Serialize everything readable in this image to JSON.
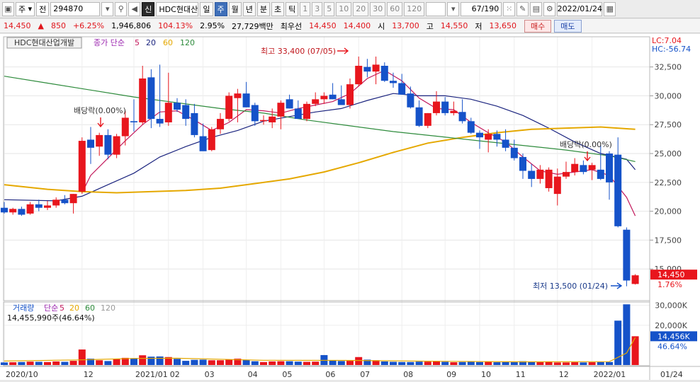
{
  "toolbar": {
    "market": "주",
    "prev_label": "전",
    "code": "294870",
    "sin_label": "신",
    "stock_name": "HDC현대산업",
    "periods": [
      "일",
      "주",
      "월",
      "년",
      "분",
      "초",
      "틱"
    ],
    "selected_period": "주",
    "numbers": [
      "1",
      "3",
      "5",
      "10",
      "20",
      "30",
      "60",
      "120"
    ],
    "count_value": "67",
    "count_total": "/190",
    "date": "2022/01/24"
  },
  "quote": {
    "price": "14,450",
    "arrow": "▲",
    "change": "850",
    "change_pct": "+6.25%",
    "volume": "1,946,806",
    "vol_ratio": "104.13%",
    "turnover": "2.95%",
    "amount": "27,729백만",
    "best_label": "최우선",
    "best_ask": "14,450",
    "best_bid": "14,400",
    "open_label": "시",
    "open": "13,700",
    "high_label": "고",
    "high": "14,550",
    "low_label": "저",
    "low": "13,650",
    "buy_label": "매수",
    "sell_label": "매도"
  },
  "chart_data": [
    {
      "type": "candlestick",
      "title": "HDC현대산업개발",
      "legend": [
        {
          "name": "종가 단순",
          "color": "#9c27b0"
        },
        {
          "name": "5",
          "color": "#c2185b"
        },
        {
          "name": "20",
          "color": "#1a237e"
        },
        {
          "name": "60",
          "color": "#e5a800"
        },
        {
          "name": "120",
          "color": "#2e8b3c"
        }
      ],
      "corner_labels": {
        "lc": "LC:7.04",
        "hc": "HC:-56.74"
      },
      "y_ticks": [
        32500,
        30000,
        27500,
        25000,
        22500,
        20000,
        17500,
        15000
      ],
      "y_tick_labels": [
        "32,500",
        "30,000",
        "27,500",
        "25,000",
        "22,500",
        "20,000",
        "17,500",
        "15,000"
      ],
      "ylim": [
        12500,
        34500
      ],
      "x_tick_labels": [
        {
          "i": 0,
          "label": "2020/10"
        },
        {
          "i": 9,
          "label": "12"
        },
        {
          "i": 15,
          "label": "2021/01"
        },
        {
          "i": 19,
          "label": "02"
        },
        {
          "i": 23,
          "label": "03"
        },
        {
          "i": 28,
          "label": "04"
        },
        {
          "i": 32,
          "label": "05"
        },
        {
          "i": 37,
          "label": "06"
        },
        {
          "i": 41,
          "label": "07"
        },
        {
          "i": 46,
          "label": "08"
        },
        {
          "i": 51,
          "label": "09"
        },
        {
          "i": 55,
          "label": "10"
        },
        {
          "i": 59,
          "label": "11"
        },
        {
          "i": 64,
          "label": "12"
        },
        {
          "i": 68,
          "label": "2022/01"
        },
        {
          "i": 76,
          "label": "01/24"
        }
      ],
      "candles": [
        [
          20300,
          20800,
          19800,
          19900
        ],
        [
          19900,
          20300,
          19700,
          20200
        ],
        [
          20200,
          20400,
          19600,
          19700
        ],
        [
          19800,
          20800,
          19700,
          20600
        ],
        [
          20600,
          21000,
          20000,
          20300
        ],
        [
          20300,
          20900,
          20100,
          20500
        ],
        [
          20500,
          21200,
          20300,
          21000
        ],
        [
          21000,
          21400,
          20600,
          20700
        ],
        [
          20700,
          21500,
          19800,
          21500
        ],
        [
          21700,
          26400,
          21500,
          26100
        ],
        [
          26200,
          27300,
          24100,
          25500
        ],
        [
          25600,
          26800,
          24800,
          26600
        ],
        [
          26600,
          27100,
          24500,
          24900
        ],
        [
          24900,
          26700,
          24600,
          26500
        ],
        [
          26500,
          28700,
          25700,
          28100
        ],
        [
          27800,
          29700,
          26900,
          27700
        ],
        [
          27700,
          32600,
          27500,
          31500
        ],
        [
          31600,
          32300,
          27200,
          28000
        ],
        [
          28000,
          32700,
          27300,
          27600
        ],
        [
          27700,
          32000,
          27400,
          29400
        ],
        [
          29400,
          29800,
          28600,
          28800
        ],
        [
          29200,
          29700,
          27400,
          28000
        ],
        [
          28500,
          29300,
          26400,
          26600
        ],
        [
          26500,
          27600,
          25300,
          25200
        ],
        [
          25300,
          27300,
          25200,
          27100
        ],
        [
          27100,
          28500,
          26700,
          28000
        ],
        [
          28000,
          30300,
          27800,
          30000
        ],
        [
          29800,
          30600,
          27700,
          30200
        ],
        [
          30200,
          31200,
          29000,
          29000
        ],
        [
          29200,
          29400,
          27400,
          27800
        ],
        [
          27800,
          28300,
          27500,
          27900
        ],
        [
          27700,
          28900,
          27200,
          28200
        ],
        [
          28200,
          29600,
          27100,
          29400
        ],
        [
          29700,
          30100,
          28900,
          28900
        ],
        [
          28900,
          29600,
          28400,
          28000
        ],
        [
          28000,
          29500,
          27800,
          29300
        ],
        [
          29300,
          30300,
          29100,
          29700
        ],
        [
          29700,
          30300,
          29300,
          30000
        ],
        [
          30100,
          31100,
          29700,
          29700
        ],
        [
          29700,
          30900,
          29200,
          29200
        ],
        [
          29200,
          31500,
          28900,
          31000
        ],
        [
          31000,
          33400,
          30800,
          32600
        ],
        [
          32500,
          33200,
          31600,
          32100
        ],
        [
          32100,
          33400,
          31000,
          32700
        ],
        [
          32600,
          32900,
          31200,
          31300
        ],
        [
          31300,
          32000,
          30700,
          31100
        ],
        [
          31100,
          31900,
          30300,
          30100
        ],
        [
          30200,
          30800,
          28900,
          29000
        ],
        [
          29000,
          29600,
          27300,
          27400
        ],
        [
          27400,
          28500,
          27200,
          28500
        ],
        [
          28500,
          30400,
          28300,
          29500
        ],
        [
          29500,
          29900,
          28300,
          28500
        ],
        [
          28500,
          29500,
          28300,
          28700
        ],
        [
          28600,
          29700,
          27600,
          27800
        ],
        [
          27800,
          28100,
          26700,
          26800
        ],
        [
          26800,
          27000,
          25400,
          26400
        ],
        [
          26200,
          27100,
          25100,
          26700
        ],
        [
          26700,
          27000,
          25600,
          26200
        ],
        [
          26200,
          27100,
          25200,
          25500
        ],
        [
          25500,
          26200,
          24400,
          24600
        ],
        [
          24700,
          25000,
          22800,
          23500
        ],
        [
          23500,
          24100,
          22100,
          22800
        ],
        [
          22800,
          24000,
          22400,
          23600
        ],
        [
          22000,
          23800,
          21700,
          23600
        ],
        [
          21500,
          23700,
          20500,
          23000
        ],
        [
          23000,
          24300,
          22800,
          23400
        ],
        [
          23400,
          24600,
          23100,
          24100
        ],
        [
          24000,
          24400,
          23200,
          23400
        ],
        [
          23600,
          24200,
          22700,
          24000
        ],
        [
          23600,
          25700,
          22700,
          22800
        ],
        [
          25000,
          25200,
          21000,
          22500
        ],
        [
          24900,
          26400,
          18600,
          18700
        ],
        [
          18400,
          18600,
          13500,
          14000
        ],
        [
          13700,
          14550,
          13650,
          14450
        ]
      ],
      "annotations": [
        {
          "text": "최고 33,400 (07/05)"
        },
        {
          "text": "최저 13,500 (01/24)"
        },
        {
          "text": "배당락(0.00%)"
        },
        {
          "text": "배당락(0.00%)"
        }
      ],
      "last_price_label": "14,450",
      "last_pct_label": "1.76%",
      "lines": {
        "ma5": [
          [
            9,
            21600
          ],
          [
            10,
            23100
          ],
          [
            12,
            24600
          ],
          [
            14,
            26100
          ],
          [
            16,
            27500
          ],
          [
            18,
            28600
          ],
          [
            20,
            28700
          ],
          [
            22,
            27900
          ],
          [
            24,
            27000
          ],
          [
            26,
            27700
          ],
          [
            28,
            28800
          ],
          [
            30,
            28700
          ],
          [
            32,
            28500
          ],
          [
            34,
            28900
          ],
          [
            36,
            29200
          ],
          [
            38,
            29500
          ],
          [
            40,
            30200
          ],
          [
            42,
            31500
          ],
          [
            44,
            32200
          ],
          [
            46,
            31300
          ],
          [
            48,
            29800
          ],
          [
            50,
            28900
          ],
          [
            52,
            28800
          ],
          [
            54,
            27700
          ],
          [
            56,
            26800
          ],
          [
            58,
            26000
          ],
          [
            60,
            24700
          ],
          [
            62,
            23500
          ],
          [
            64,
            23200
          ],
          [
            66,
            23400
          ],
          [
            68,
            23600
          ],
          [
            70,
            23100
          ],
          [
            72,
            21200
          ],
          [
            73,
            19600
          ]
        ],
        "ma20": [
          [
            0,
            21000
          ],
          [
            6,
            20900
          ],
          [
            9,
            21300
          ],
          [
            12,
            22300
          ],
          [
            15,
            23300
          ],
          [
            18,
            24700
          ],
          [
            21,
            25600
          ],
          [
            24,
            26400
          ],
          [
            27,
            27000
          ],
          [
            30,
            27800
          ],
          [
            33,
            28200
          ],
          [
            36,
            28600
          ],
          [
            39,
            28900
          ],
          [
            42,
            29600
          ],
          [
            45,
            30200
          ],
          [
            48,
            30000
          ],
          [
            51,
            30000
          ],
          [
            54,
            29700
          ],
          [
            57,
            29100
          ],
          [
            60,
            28300
          ],
          [
            63,
            27200
          ],
          [
            66,
            26000
          ],
          [
            69,
            25000
          ],
          [
            72,
            24500
          ],
          [
            73,
            23600
          ]
        ],
        "ma60": [
          [
            0,
            22300
          ],
          [
            5,
            21900
          ],
          [
            9,
            21700
          ],
          [
            13,
            21600
          ],
          [
            17,
            21700
          ],
          [
            21,
            21800
          ],
          [
            25,
            22000
          ],
          [
            29,
            22400
          ],
          [
            33,
            22800
          ],
          [
            37,
            23400
          ],
          [
            41,
            24200
          ],
          [
            45,
            25100
          ],
          [
            49,
            25900
          ],
          [
            53,
            26400
          ],
          [
            57,
            26800
          ],
          [
            61,
            27100
          ],
          [
            65,
            27200
          ],
          [
            69,
            27300
          ],
          [
            73,
            27100
          ]
        ],
        "ma120": [
          [
            0,
            31700
          ],
          [
            5,
            31100
          ],
          [
            10,
            30500
          ],
          [
            15,
            29900
          ],
          [
            20,
            29400
          ],
          [
            25,
            28900
          ],
          [
            30,
            28500
          ],
          [
            35,
            27900
          ],
          [
            40,
            27400
          ],
          [
            45,
            26900
          ],
          [
            50,
            26500
          ],
          [
            55,
            26100
          ],
          [
            60,
            25700
          ],
          [
            65,
            25300
          ],
          [
            70,
            24800
          ],
          [
            73,
            24300
          ]
        ]
      }
    },
    {
      "type": "bar",
      "title": "거래량",
      "legend": [
        {
          "name": "단순",
          "color": "#9c27b0"
        },
        {
          "name": "5",
          "color": "#c2185b"
        },
        {
          "name": "20",
          "color": "#e5a800"
        },
        {
          "name": "60",
          "color": "#2e8b3c"
        },
        {
          "name": "120",
          "color": "#999999"
        }
      ],
      "readout": "14,455,990주(46.64%)",
      "y_ticks": [
        20000,
        30000
      ],
      "y_tick_labels": [
        "20,000K",
        "30,000K"
      ],
      "ylim": [
        0,
        32000
      ],
      "last_value_label": "14,456K",
      "last_pct_label": "46.64%",
      "values": [
        1300,
        1400,
        1500,
        1700,
        1600,
        1500,
        1800,
        1600,
        2100,
        7800,
        3200,
        2400,
        2000,
        3000,
        3600,
        3400,
        4900,
        4200,
        4300,
        4000,
        3100,
        2100,
        2600,
        2700,
        2400,
        2400,
        2700,
        3200,
        2600,
        1900,
        1500,
        1800,
        1900,
        1900,
        1700,
        1600,
        1700,
        5000,
        2500,
        2000,
        2100,
        4000,
        2700,
        2400,
        1800,
        1600,
        1500,
        1500,
        1700,
        1700,
        2000,
        1600,
        1400,
        1500,
        1800,
        1500,
        1600,
        1400,
        1500,
        1400,
        1900,
        1600,
        1400,
        1800,
        1300,
        1300,
        1400,
        1300,
        1400,
        1500,
        1500,
        22300,
        30500,
        14456
      ],
      "up_flags": [
        false,
        true,
        false,
        true,
        false,
        true,
        true,
        false,
        true,
        true,
        false,
        true,
        false,
        true,
        true,
        false,
        true,
        false,
        false,
        true,
        false,
        false,
        false,
        false,
        true,
        true,
        true,
        true,
        false,
        false,
        true,
        true,
        true,
        false,
        false,
        true,
        true,
        false,
        false,
        false,
        true,
        true,
        false,
        true,
        false,
        false,
        false,
        false,
        false,
        true,
        true,
        false,
        true,
        false,
        false,
        false,
        true,
        false,
        false,
        false,
        false,
        false,
        true,
        true,
        true,
        true,
        true,
        false,
        true,
        false,
        false,
        false,
        false,
        true
      ],
      "ma": [
        [
          0,
          2000
        ],
        [
          9,
          2600
        ],
        [
          15,
          3300
        ],
        [
          20,
          3400
        ],
        [
          30,
          2400
        ],
        [
          40,
          2300
        ],
        [
          50,
          1900
        ],
        [
          60,
          1600
        ],
        [
          70,
          1700
        ],
        [
          72,
          6000
        ],
        [
          73,
          13800
        ]
      ]
    }
  ]
}
